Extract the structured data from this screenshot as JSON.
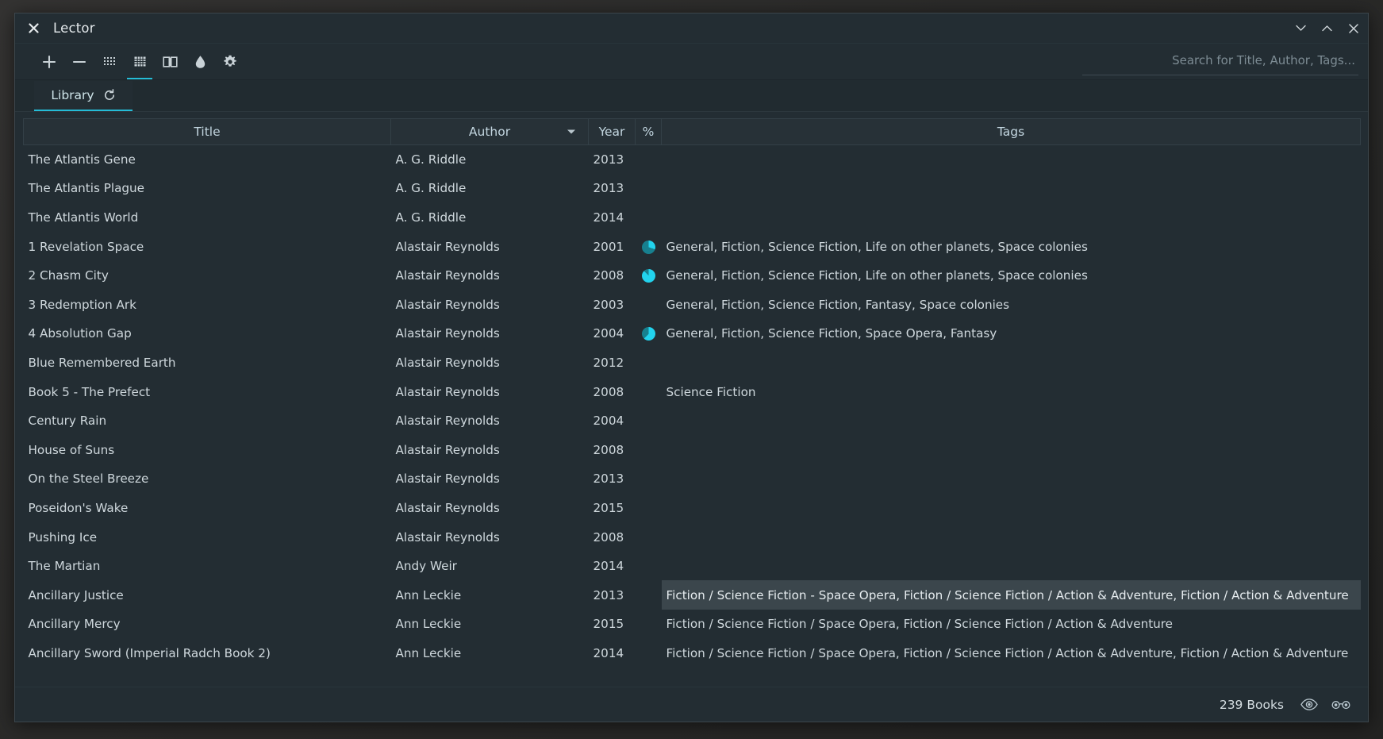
{
  "window": {
    "title": "Lector",
    "close_icon": "close-icon",
    "minimize_icon": "chevron-down-icon",
    "maximize_icon": "chevron-up-icon",
    "window_close_icon": "close-icon"
  },
  "toolbar": {
    "items": [
      {
        "name": "add-books-button",
        "icon": "plus-icon",
        "active": false
      },
      {
        "name": "remove-books-button",
        "icon": "minus-icon",
        "active": false
      },
      {
        "name": "cover-view-button",
        "icon": "dots-grid-icon",
        "active": false
      },
      {
        "name": "table-view-button",
        "icon": "table-grid-icon",
        "active": true
      },
      {
        "name": "reading-view-button",
        "icon": "open-book-icon",
        "active": false
      },
      {
        "name": "theme-button",
        "icon": "droplet-icon",
        "active": false
      },
      {
        "name": "settings-button",
        "icon": "gear-icon",
        "active": false
      }
    ]
  },
  "search": {
    "placeholder": "Search for Title, Author, Tags...",
    "value": ""
  },
  "tabs": [
    {
      "label": "Library",
      "icon": "reload-icon",
      "active": true
    }
  ],
  "table": {
    "columns": [
      {
        "key": "title",
        "label": "Title",
        "sorted": false
      },
      {
        "key": "author",
        "label": "Author",
        "sorted": true
      },
      {
        "key": "year",
        "label": "Year",
        "sorted": false
      },
      {
        "key": "pct",
        "label": "%",
        "sorted": false
      },
      {
        "key": "tags",
        "label": "Tags",
        "sorted": false
      }
    ],
    "rows": [
      {
        "title": "The Atlantis Gene",
        "author": "A. G. Riddle",
        "year": "2013",
        "progress": null,
        "tags": "",
        "selected": false
      },
      {
        "title": "The Atlantis Plague",
        "author": "A. G. Riddle",
        "year": "2013",
        "progress": null,
        "tags": "",
        "selected": false
      },
      {
        "title": "The Atlantis World",
        "author": "A. G. Riddle",
        "year": "2014",
        "progress": null,
        "tags": "",
        "selected": false
      },
      {
        "title": "1 Revelation Space",
        "author": "Alastair Reynolds",
        "year": "2001",
        "progress": 30,
        "tags": "General, Fiction, Science Fiction, Life on other planets, Space colonies",
        "selected": false
      },
      {
        "title": "2 Chasm City",
        "author": "Alastair Reynolds",
        "year": "2008",
        "progress": 88,
        "tags": "General, Fiction, Science Fiction, Life on other planets, Space colonies",
        "selected": false
      },
      {
        "title": "3 Redemption Ark",
        "author": "Alastair Reynolds",
        "year": "2003",
        "progress": null,
        "tags": "General, Fiction, Science Fiction, Fantasy, Space colonies",
        "selected": false
      },
      {
        "title": "4 Absolution Gap",
        "author": "Alastair Reynolds",
        "year": "2004",
        "progress": 62,
        "tags": "General, Fiction, Science Fiction, Space Opera, Fantasy",
        "selected": false
      },
      {
        "title": "Blue Remembered Earth",
        "author": "Alastair Reynolds",
        "year": "2012",
        "progress": null,
        "tags": "",
        "selected": false
      },
      {
        "title": "Book 5 - The Prefect",
        "author": "Alastair Reynolds",
        "year": "2008",
        "progress": null,
        "tags": "Science Fiction",
        "selected": false
      },
      {
        "title": "Century Rain",
        "author": "Alastair Reynolds",
        "year": "2004",
        "progress": null,
        "tags": "",
        "selected": false
      },
      {
        "title": "House of Suns",
        "author": "Alastair Reynolds",
        "year": "2008",
        "progress": null,
        "tags": "",
        "selected": false
      },
      {
        "title": "On the Steel Breeze",
        "author": "Alastair Reynolds",
        "year": "2013",
        "progress": null,
        "tags": "",
        "selected": false
      },
      {
        "title": "Poseidon's Wake",
        "author": "Alastair Reynolds",
        "year": "2015",
        "progress": null,
        "tags": "",
        "selected": false
      },
      {
        "title": "Pushing Ice",
        "author": "Alastair Reynolds",
        "year": "2008",
        "progress": null,
        "tags": "",
        "selected": false
      },
      {
        "title": "The Martian",
        "author": "Andy Weir",
        "year": "2014",
        "progress": null,
        "tags": "",
        "selected": false
      },
      {
        "title": "Ancillary Justice",
        "author": "Ann Leckie",
        "year": "2013",
        "progress": null,
        "tags": "Fiction / Science Fiction - Space Opera, Fiction / Science Fiction / Action & Adventure, Fiction / Action & Adventure",
        "selected": true
      },
      {
        "title": "Ancillary Mercy",
        "author": "Ann Leckie",
        "year": "2015",
        "progress": null,
        "tags": "Fiction / Science Fiction / Space Opera, Fiction / Science Fiction / Action & Adventure",
        "selected": false
      },
      {
        "title": "Ancillary Sword (Imperial Radch Book 2)",
        "author": "Ann Leckie",
        "year": "2014",
        "progress": null,
        "tags": "Fiction / Science Fiction / Space Opera, Fiction / Science Fiction / Action & Adventure, Fiction / Action & Adventure",
        "selected": false
      }
    ]
  },
  "statusbar": {
    "count_label": "239 Books",
    "icons": [
      {
        "name": "eye-icon",
        "glyph": "eye"
      },
      {
        "name": "glasses-icon",
        "glyph": "glasses"
      }
    ]
  },
  "colors": {
    "accent": "#25bcd6",
    "window_bg": "#232d33",
    "header_bg": "#273137",
    "text": "#cfd8dd",
    "selection": "#3b464c",
    "pie_fill": "#22d3ee",
    "pie_track": "#17808f"
  }
}
